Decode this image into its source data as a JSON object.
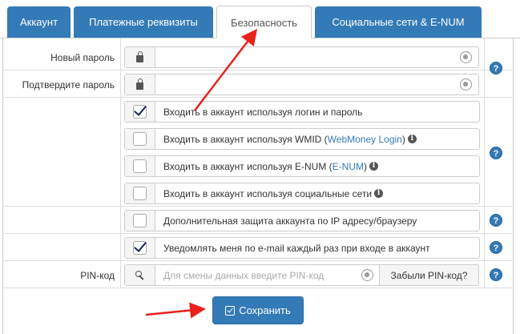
{
  "tabs": [
    {
      "label": "Аккаунт"
    },
    {
      "label": "Платежные реквизиты"
    },
    {
      "label": "Безопасность"
    },
    {
      "label": "Социальные сети & E-NUM"
    }
  ],
  "form": {
    "new_password_label": "Новый пароль",
    "new_password_value": "",
    "confirm_password_label": "Подтвердите пароль",
    "confirm_password_value": "",
    "options": [
      {
        "text": "Входить в аккаунт используя логин и пароль",
        "checked": true
      },
      {
        "text_before": "Входить в аккаунт используя WMID (",
        "link": "WebMoney Login",
        "text_after": ")",
        "checked": false,
        "info": true
      },
      {
        "text_before": "Входить в аккаунт используя E-NUM (",
        "link": "E-NUM",
        "text_after": ")",
        "checked": false,
        "info": true
      },
      {
        "text": "Входить в аккаунт используя социальные сети",
        "checked": false,
        "info": true
      },
      {
        "text": "Дополнительная защита аккаунта по IP адресу/браузеру",
        "checked": false
      },
      {
        "text": "Уведомлять меня по e-mail каждый раз при входе в аккаунт",
        "checked": true
      }
    ],
    "pin_label": "PIN-код",
    "pin_placeholder": "Для смены данных введите PIN-код",
    "forgot_pin_label": "Забыли PIN-код?",
    "help_symbol": "?",
    "info_symbol": "i",
    "save_label": "Сохранить"
  },
  "colors": {
    "primary": "#337ab7",
    "annotation_arrow": "#e8211a"
  },
  "icons": {
    "lock": "lock-icon",
    "key": "key-icon",
    "eye": "eye-icon",
    "help": "help-icon",
    "save": "save-icon",
    "info": "info-icon"
  }
}
